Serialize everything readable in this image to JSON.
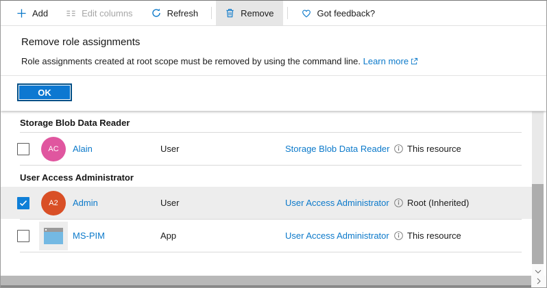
{
  "toolbar": {
    "add": "Add",
    "edit_columns": "Edit columns",
    "refresh": "Refresh",
    "remove": "Remove",
    "feedback": "Got feedback?"
  },
  "dialog": {
    "title": "Remove role assignments",
    "message": "Role assignments created at root scope must be removed by using the command line.",
    "learn_more": "Learn more",
    "ok": "OK"
  },
  "groups": [
    {
      "header": "Storage Blob Data Reader",
      "rows": [
        {
          "name": "Alain",
          "type": "User",
          "role": "Storage Blob Data Reader",
          "scope": "This resource",
          "avatar_text": "AC",
          "avatar_color": "#e0569f",
          "checked": false,
          "highlighted": false
        }
      ]
    },
    {
      "header": "User Access Administrator",
      "rows": [
        {
          "name": "Admin",
          "type": "User",
          "role": "User Access Administrator",
          "scope": "Root (Inherited)",
          "avatar_text": "A2",
          "avatar_color": "#d94f26",
          "checked": true,
          "highlighted": true
        },
        {
          "name": "MS-PIM",
          "type": "App",
          "role": "User Access Administrator",
          "scope": "This resource",
          "avatar_kind": "app-window-icon",
          "checked": false,
          "highlighted": false
        }
      ]
    }
  ],
  "colors": {
    "accent_blue": "#0b79ca",
    "ok_button_fill": "#0d78d1",
    "ok_button_border": "#004f87",
    "avatar_pink": "#e0569f",
    "avatar_orange": "#d94f26",
    "row_highlight": "#ededed",
    "toolbar_active_bg": "#e6e6e6",
    "scroll_thumb": "#adadad"
  }
}
